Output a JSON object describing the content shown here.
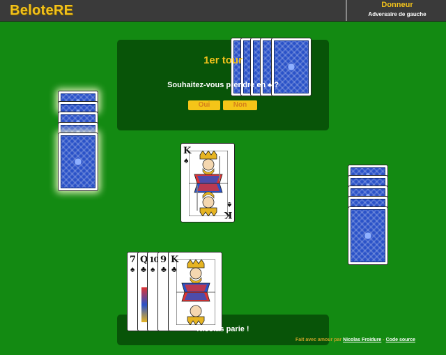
{
  "app": {
    "title": "BeloteRE"
  },
  "role": {
    "title": "Donneur",
    "subtitle": "Adversaire de gauche"
  },
  "prompt": {
    "round_title": "1er tour",
    "question": "Souhaitez-vous prendre en ♠ ?",
    "yes_label": "Oui",
    "no_label": "Non"
  },
  "table": {
    "played_card": {
      "rank": "K",
      "suit": "♠"
    }
  },
  "hand": {
    "cards": [
      {
        "rank": "7",
        "suit": "♠"
      },
      {
        "rank": "Q",
        "suit": "♣"
      },
      {
        "rank": "10",
        "suit": "♠"
      },
      {
        "rank": "9",
        "suit": "♣"
      },
      {
        "rank": "K",
        "suit": "♣"
      }
    ]
  },
  "status": {
    "message": "Nicolas parie !"
  },
  "footer": {
    "made_with": "Fait avec amour par",
    "author": "Nicolas Froidure",
    "separator": "-",
    "source": "Code source"
  },
  "colors": {
    "table": "#138a12",
    "accent": "#f2c21b",
    "card_back": "#2a52c8"
  }
}
